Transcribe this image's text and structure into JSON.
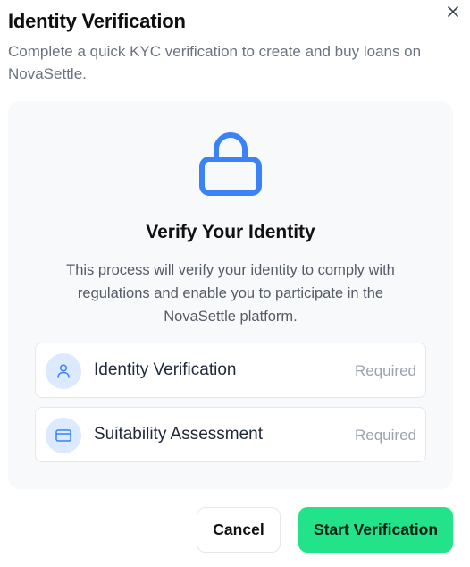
{
  "dialog": {
    "title": "Identity Verification",
    "subtitle": "Complete a quick KYC verification to create and buy loans on NovaSettle.",
    "close_icon": "close-icon"
  },
  "panel": {
    "icon": "lock-icon",
    "heading": "Verify Your Identity",
    "description": "This process will verify your identity to comply with regulations and enable you to participate in the NovaSettle platform.",
    "items": [
      {
        "icon": "user-icon",
        "label": "Identity Verification",
        "status": "Required"
      },
      {
        "icon": "credit-card-icon",
        "label": "Suitability Assessment",
        "status": "Required"
      }
    ]
  },
  "actions": {
    "cancel_label": "Cancel",
    "start_label": "Start Verification"
  },
  "colors": {
    "accent_blue": "#3b82f6",
    "icon_badge_bg": "#dbeafe",
    "primary_button": "#22e38a",
    "panel_bg": "#f8f9fb"
  }
}
